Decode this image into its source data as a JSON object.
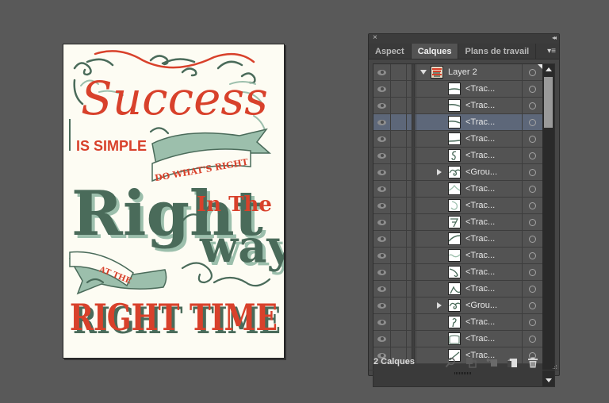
{
  "artboard": {
    "headline": "Success",
    "line_is_simple": "IS SIMPLE",
    "banner_do_whats_right": "DO WHAT'S RIGHT",
    "word_right": "Right",
    "word_in_the": "In The",
    "word_way": "way",
    "banner_at_the": "AT THE",
    "line_right_time": "RIGHT TIME",
    "colors": {
      "paper": "#fdfcf3",
      "red": "#d8412b",
      "dark_green": "#4a6b5a",
      "light_green": "#9cbfac"
    }
  },
  "panel": {
    "close_icon": "×",
    "collapse_icon": "◂◂",
    "menu_icon": "▾≡",
    "tabs": [
      {
        "label": "Aspect",
        "active": false
      },
      {
        "label": "Calques",
        "active": true
      },
      {
        "label": "Plans de travail",
        "active": false
      }
    ],
    "layers": [
      {
        "name": "Layer 2",
        "type": "layer",
        "expanded": true,
        "selected": false,
        "thumb": "artwork"
      },
      {
        "name": "<Trac...",
        "type": "path",
        "selected": false,
        "thumb": "line-flat"
      },
      {
        "name": "<Trac...",
        "type": "path",
        "selected": false,
        "thumb": "line-curve"
      },
      {
        "name": "<Trac...",
        "type": "path",
        "selected": true,
        "thumb": "line-curve"
      },
      {
        "name": "<Trac...",
        "type": "path",
        "selected": false,
        "thumb": "line-low"
      },
      {
        "name": "<Trac...",
        "type": "path",
        "selected": false,
        "thumb": "s-curl"
      },
      {
        "name": "<Grou...",
        "type": "group",
        "expanded": false,
        "selected": false,
        "thumb": "swirl"
      },
      {
        "name": "<Trac...",
        "type": "path",
        "selected": false,
        "thumb": "peak"
      },
      {
        "name": "<Trac...",
        "type": "path",
        "selected": false,
        "thumb": "hook"
      },
      {
        "name": "<Trac...",
        "type": "path",
        "selected": false,
        "thumb": "seven"
      },
      {
        "name": "<Trac...",
        "type": "path",
        "selected": false,
        "thumb": "arc"
      },
      {
        "name": "<Trac...",
        "type": "path",
        "selected": false,
        "thumb": "wave"
      },
      {
        "name": "<Trac...",
        "type": "path",
        "selected": false,
        "thumb": "corner-curl"
      },
      {
        "name": "<Trac...",
        "type": "path",
        "selected": false,
        "thumb": "slope"
      },
      {
        "name": "<Grou...",
        "type": "group",
        "expanded": false,
        "selected": false,
        "thumb": "swirl"
      },
      {
        "name": "<Trac...",
        "type": "path",
        "selected": false,
        "thumb": "question"
      },
      {
        "name": "<Trac...",
        "type": "path",
        "selected": false,
        "thumb": "frame"
      },
      {
        "name": "<Trac...",
        "type": "path",
        "selected": false,
        "thumb": "diag"
      }
    ],
    "footer": {
      "layer_count": "2 Calques",
      "icons": [
        "locate-object-icon",
        "make-clipping-mask-icon",
        "new-sublayer-icon",
        "new-layer-icon",
        "trash-icon"
      ]
    }
  }
}
